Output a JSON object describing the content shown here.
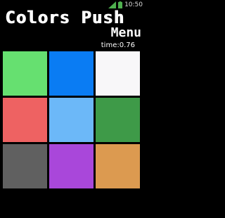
{
  "status_bar": {
    "time": "10:50",
    "icons": [
      "signal-icon",
      "battery-icon"
    ]
  },
  "game": {
    "title": "Colors Push",
    "menu_label": "Menu",
    "timer_text": "time:0.76",
    "tiles": [
      {
        "color": "#66e070"
      },
      {
        "color": "#0a7cf3"
      },
      {
        "color": "#f8f7f9"
      },
      {
        "color": "#ee6262"
      },
      {
        "color": "#6cb8f8"
      },
      {
        "color": "#3e9a48"
      },
      {
        "color": "#606060"
      },
      {
        "color": "#a947da"
      },
      {
        "color": "#dc9a50"
      }
    ]
  }
}
